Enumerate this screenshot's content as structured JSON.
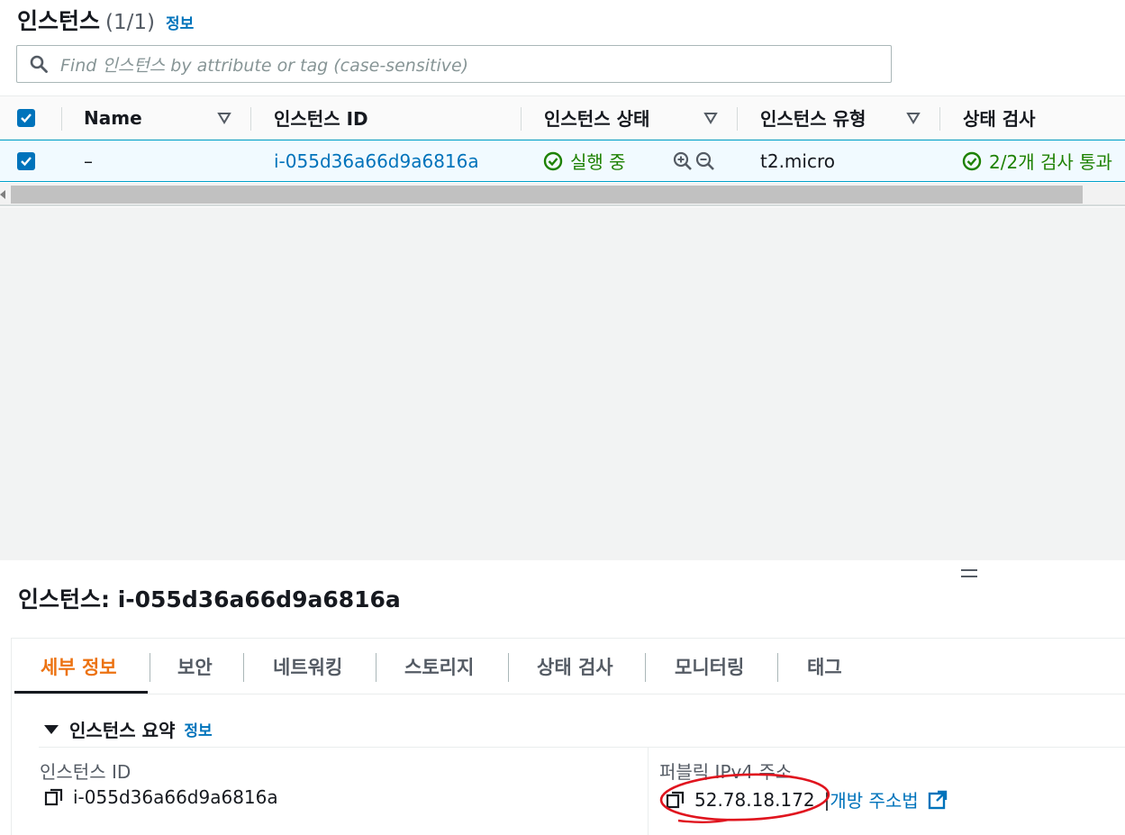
{
  "header": {
    "title": "인스턴스",
    "count": "(1/1)",
    "info_label": "정보"
  },
  "search": {
    "placeholder": "Find 인스턴스 by attribute or tag (case-sensitive)"
  },
  "table": {
    "columns": [
      "Name",
      "인스턴스 ID",
      "인스턴스 상태",
      "인스턴스 유형",
      "상태 검사"
    ],
    "rows": [
      {
        "name": "–",
        "instance_id": "i-055d36a66d9a6816a",
        "state": "실행 중",
        "type": "t2.micro",
        "status_check": "2/2개 검사 통과"
      }
    ]
  },
  "detail": {
    "title": "인스턴스: i-055d36a66d9a6816a",
    "tabs": [
      "세부 정보",
      "보안",
      "네트워킹",
      "스토리지",
      "상태 검사",
      "모니터링",
      "태그"
    ],
    "active_tab": "세부 정보",
    "section": {
      "title": "인스턴스 요약",
      "info_label": "정보"
    },
    "fields": {
      "instance_id_label": "인스턴스 ID",
      "instance_id_value": "i-055d36a66d9a6816a",
      "public_ip_label": "퍼블릭 IPv4 주소",
      "public_ip_value": "52.78.18.172",
      "open_address_label": "개방 주소법"
    }
  },
  "colors": {
    "link": "#0073bb",
    "success": "#1d8102",
    "active_tab": "#ec7211",
    "annotation": "#e0141e"
  },
  "icons": [
    "search-icon",
    "checkbox-checked-icon",
    "sort-icon",
    "check-circle-icon",
    "zoom-in-icon",
    "zoom-out-icon",
    "copy-icon",
    "external-link-icon",
    "drag-handle-icon"
  ]
}
